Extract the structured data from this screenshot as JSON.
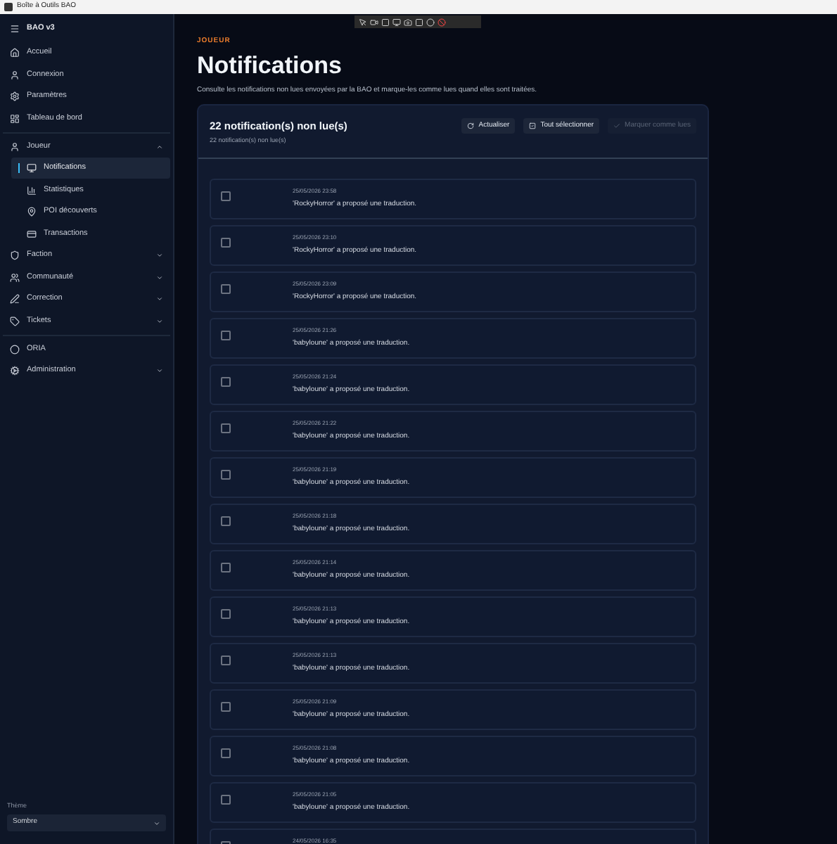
{
  "window": {
    "title": "Boîte à Outils BAO"
  },
  "sidebar": {
    "app_name": "BAO v3",
    "groups": [
      [
        {
          "label": "Accueil",
          "selected": false
        },
        {
          "label": "Connexion",
          "selected": false
        },
        {
          "label": "Paramètres",
          "selected": false
        },
        {
          "label": "Tableau de bord",
          "selected": false
        }
      ],
      [
        {
          "label": "Joueur",
          "selected": false,
          "expanded": true,
          "children": [
            {
              "label": "Notifications",
              "selected": true
            },
            {
              "label": "Statistiques",
              "selected": false
            },
            {
              "label": "POI découverts",
              "selected": false
            },
            {
              "label": "Transactions",
              "selected": false
            }
          ]
        },
        {
          "label": "Faction",
          "selected": false,
          "expanded": false
        },
        {
          "label": "Communauté",
          "selected": false,
          "expanded": false
        },
        {
          "label": "Correction",
          "selected": false,
          "expanded": false
        },
        {
          "label": "Tickets",
          "selected": false,
          "expanded": false
        }
      ],
      [
        {
          "label": "ORIA",
          "selected": false
        },
        {
          "label": "Administration",
          "selected": false,
          "expanded": false
        }
      ]
    ],
    "theme": {
      "label": "Thème",
      "value": "Sombre"
    }
  },
  "page": {
    "section": "JOUEUR",
    "title": "Notifications",
    "description": "Consulte les notifications non lues envoyées par la BAO et marque-les comme lues quand elles sont traitées."
  },
  "card": {
    "title": "22 notification(s) non lue(s)",
    "subtitle": "22 notification(s) non lue(s)",
    "buttons": [
      {
        "label": "Actualiser",
        "disabled": false
      },
      {
        "label": "Tout sélectionner",
        "disabled": false
      },
      {
        "label": "Marquer comme lues",
        "disabled": true
      }
    ],
    "notifications": [
      {
        "date": "25/05/2026 23:58",
        "message": "'RockyHorror' a proposé une traduction.",
        "checked": false
      },
      {
        "date": "25/05/2026 23:10",
        "message": "'RockyHorror' a proposé une traduction.",
        "checked": false
      },
      {
        "date": "25/05/2026 23:09",
        "message": "'RockyHorror' a proposé une traduction.",
        "checked": false
      },
      {
        "date": "25/05/2026 21:26",
        "message": "'babyloune' a proposé une traduction.",
        "checked": false
      },
      {
        "date": "25/05/2026 21:24",
        "message": "'babyloune' a proposé une traduction.",
        "checked": false
      },
      {
        "date": "25/05/2026 21:22",
        "message": "'babyloune' a proposé une traduction.",
        "checked": false
      },
      {
        "date": "25/05/2026 21:19",
        "message": "'babyloune' a proposé une traduction.",
        "checked": false
      },
      {
        "date": "25/05/2026 21:18",
        "message": "'babyloune' a proposé une traduction.",
        "checked": false
      },
      {
        "date": "25/05/2026 21:14",
        "message": "'babyloune' a proposé une traduction.",
        "checked": false
      },
      {
        "date": "25/05/2026 21:13",
        "message": "'babyloune' a proposé une traduction.",
        "checked": false
      },
      {
        "date": "25/05/2026 21:13",
        "message": "'babyloune' a proposé une traduction.",
        "checked": false
      },
      {
        "date": "25/05/2026 21:09",
        "message": "'babyloune' a proposé une traduction.",
        "checked": false
      },
      {
        "date": "25/05/2026 21:08",
        "message": "'babyloune' a proposé une traduction.",
        "checked": false
      },
      {
        "date": "25/05/2026 21:05",
        "message": "'babyloune' a proposé une traduction.",
        "checked": false
      },
      {
        "date": "24/05/2026 16:35",
        "checked": false
      }
    ]
  }
}
